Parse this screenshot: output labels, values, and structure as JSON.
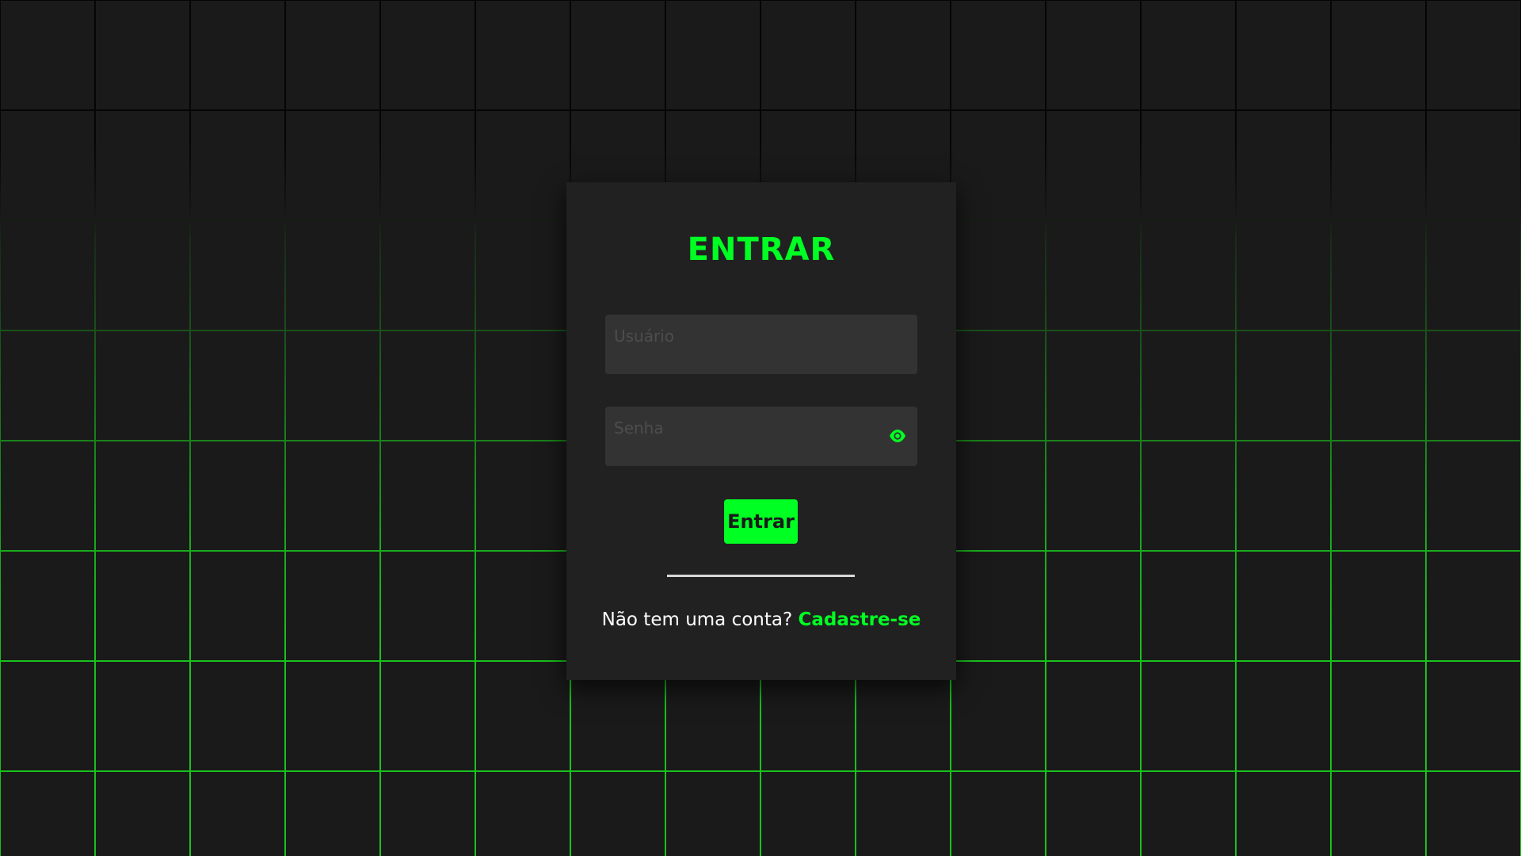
{
  "theme": {
    "accent": "#00ff22",
    "grid_color": "#18c21c",
    "background": "#1a1a1a",
    "card_background": "#212121"
  },
  "login": {
    "title": "ENTRAR",
    "username_placeholder": "Usuário",
    "username_value": "",
    "password_placeholder": "Senha",
    "password_value": "",
    "toggle_icon": "eye-icon",
    "submit_label": "Entrar",
    "signup_prompt": "Não tem uma conta?",
    "signup_link": "Cadastre-se"
  }
}
